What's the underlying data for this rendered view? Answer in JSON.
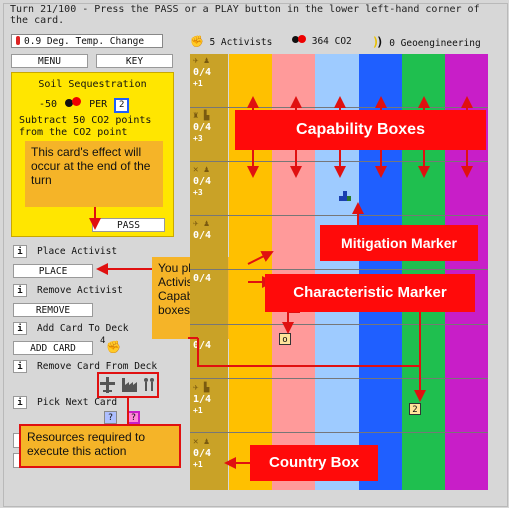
{
  "header": {
    "turn_text": "Turn 21/100 - Press the PASS or a PLAY button in the lower left-hand corner of the card."
  },
  "stats": {
    "temp_change": "0.9 Deg. Temp. Change",
    "activists": "5 Activists",
    "co2": "364 CO2",
    "geoengineering": "0 Geoengineering"
  },
  "menu": {
    "menu_label": "MENU",
    "key_label": "KEY"
  },
  "card": {
    "title": "Soil Sequestration",
    "cost": "-50",
    "per_label": "PER",
    "per_value": "2",
    "desc_line1": "Subtract 50 CO2 points",
    "desc_line2": "from the CO2 point",
    "pass_label": "PASS"
  },
  "actions": {
    "info_symbol": "i",
    "place_activist": "Place Activist",
    "place_button": "PLACE",
    "remove_activist": "Remove Activist",
    "remove_button": "REMOVE",
    "add_card_to_deck": "Add Card To Deck",
    "add_card_button": "ADD CARD",
    "add_card_cost": "4",
    "remove_card_from_deck": "Remove Card From Deck",
    "pick_next_card": "Pick Next Card",
    "pick_q1": "?",
    "pick_q2": "?"
  },
  "country_boxes": [
    {
      "value": "0/4",
      "bonus": "+1"
    },
    {
      "value": "0/4",
      "bonus": "+3"
    },
    {
      "value": "0/4",
      "bonus": "+3"
    },
    {
      "value": "0/4",
      "bonus": ""
    },
    {
      "value": "0/4",
      "bonus": ""
    },
    {
      "value": "0/4",
      "bonus": ""
    },
    {
      "value": "1/4",
      "bonus": "+1"
    },
    {
      "value": "0/4",
      "bonus": "+1"
    }
  ],
  "markers": {
    "characteristic_o": "o",
    "characteristic_2": "2"
  },
  "callouts": {
    "capability_boxes": "Capability Boxes",
    "mitigation_marker": "Mitigation Marker",
    "characteristic_marker": "Characteristic Marker",
    "country_box": "Country Box",
    "card_effect": "This card's effect will occur at the end of the turn",
    "place_activists": "You place Activists in Capability boxes",
    "resources_required": "Resources required to execute this action"
  },
  "colors": {
    "country": "#c9a227",
    "columns": [
      "#ffc000",
      "#ff9a9a",
      "#9ecbff",
      "#1f5fff",
      "#1fbf4f",
      "#c81ec8"
    ],
    "callout_red": "#ff0a0a",
    "callout_orange": "#f5b428",
    "card_yellow": "#ffe600"
  }
}
